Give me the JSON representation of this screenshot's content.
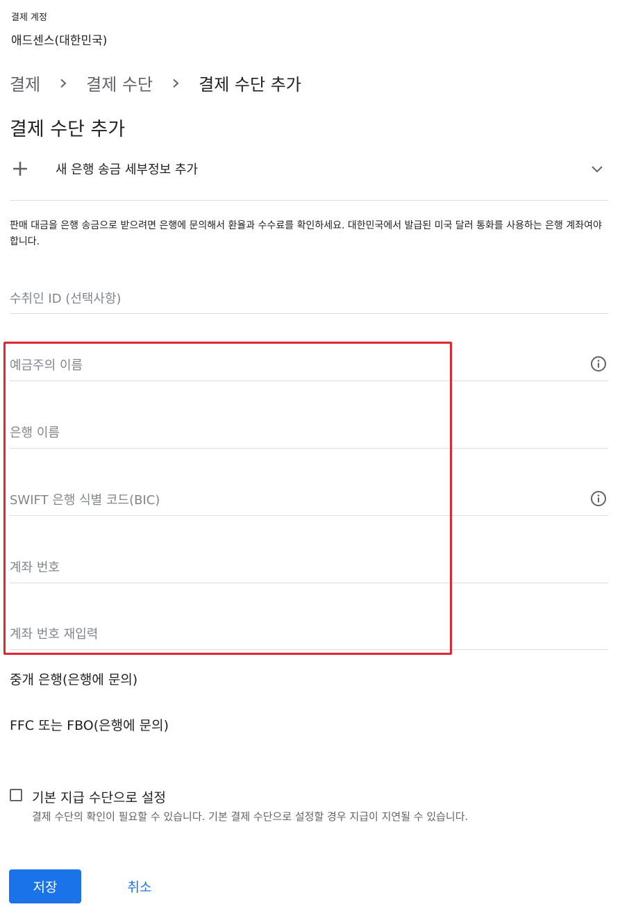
{
  "account": {
    "label": "결제 계정",
    "name": "애드센스(대한민국)"
  },
  "breadcrumb": {
    "items": [
      "결제",
      "결제 수단",
      "결제 수단 추가"
    ]
  },
  "page_title": "결제 수단 추가",
  "expander": {
    "label": "새 은행 송금 세부정보 추가",
    "icon_left": "plus-icon",
    "icon_right": "chevron-down-icon"
  },
  "info_text": "판매 대금을 은행 송금으로 받으려면 은행에 문의해서 환율과 수수료를 확인하세요. 대한민국에서 발급된 미국 달러 통화를 사용하는 은행 계좌여야 합니다.",
  "fields": {
    "recipient_id": {
      "placeholder": "수취인 ID (선택사항)",
      "value": ""
    },
    "account_holder": {
      "placeholder": "예금주의 이름",
      "value": ""
    },
    "bank_name": {
      "placeholder": "은행 이름",
      "value": ""
    },
    "swift": {
      "placeholder": "SWIFT 은행 식별 코드(BIC)",
      "value": ""
    },
    "account_number": {
      "placeholder": "계좌 번호",
      "value": ""
    },
    "account_number_confirm": {
      "placeholder": "계좌 번호 재입력",
      "value": ""
    }
  },
  "links": {
    "intermediary_bank": "중개 은행(은행에 문의)",
    "ffc_fbo": "FFC 또는 FBO(은행에 문의)"
  },
  "default_checkbox": {
    "label": "기본 지급 수단으로 설정",
    "help": "결제 수단의 확인이 필요할 수 있습니다. 기본 결제 수단으로 설정할 경우 지급이 지연될 수 있습니다.",
    "checked": false
  },
  "buttons": {
    "save": "저장",
    "cancel": "취소"
  },
  "colors": {
    "primary": "#1a73e8",
    "highlight_box": "#e3262e",
    "divider": "#dadce0",
    "placeholder": "#80868b"
  }
}
